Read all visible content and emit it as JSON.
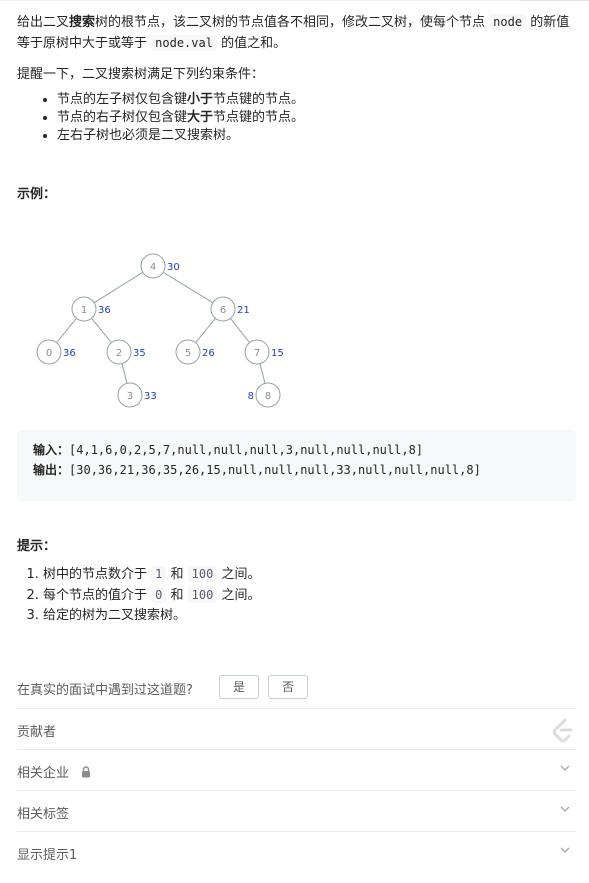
{
  "description": {
    "p1": [
      "给出二叉",
      "搜索",
      "树的根节点，该二叉树的节点值各不相同，修改二叉树，使每个节点 ",
      "node",
      " 的新值等于原树中大于或等于 ",
      "node.val",
      " 的值之和。"
    ],
    "reminder": "提醒一下，二叉搜索树满足下列约束条件：",
    "constraints": [
      [
        "节点的左子树仅包含键",
        "小于",
        "节点键的节点。"
      ],
      [
        "节点的右子树仅包含键",
        "大于",
        "节点键的节点。"
      ],
      [
        "左右子树也必须是二叉搜索树。",
        "",
        ""
      ]
    ]
  },
  "example": {
    "title": "示例：",
    "tree": {
      "nodes": [
        {
          "id": "4",
          "sum": "30"
        },
        {
          "id": "1",
          "sum": "36"
        },
        {
          "id": "6",
          "sum": "21"
        },
        {
          "id": "0",
          "sum": "36"
        },
        {
          "id": "2",
          "sum": "35"
        },
        {
          "id": "5",
          "sum": "26"
        },
        {
          "id": "7",
          "sum": "15"
        },
        {
          "id": "3",
          "sum": "33"
        },
        {
          "id": "8",
          "sum": "8"
        }
      ],
      "colors": {
        "node_stroke": "#9aa0a6",
        "node_text": "#8c8c8c",
        "sum_text": "#1f3ec7",
        "edge": "#9aa0a6"
      }
    },
    "input_label": "输入：",
    "input_value": "[4,1,6,0,2,5,7,null,null,null,3,null,null,null,8]",
    "output_label": "输出：",
    "output_value": "[30,36,21,36,35,26,15,null,null,null,33,null,null,null,8]"
  },
  "hints": {
    "title": "提示：",
    "items": [
      [
        "树中的节点数介于 ",
        "1",
        " 和 ",
        "100",
        " 之间。"
      ],
      [
        "每个节点的值介于 ",
        "0",
        " 和 ",
        "100",
        " 之间。"
      ],
      [
        "给定的树为二叉搜索树。",
        "",
        "",
        "",
        ""
      ]
    ]
  },
  "faq": {
    "question": "在真实的面试中遇到过这道题?",
    "yes": "是",
    "no": "否"
  },
  "sections": [
    {
      "label": "贡献者",
      "icon": "leetcode-logo-icon"
    },
    {
      "label": "相关企业",
      "icon": "chevron-down-icon",
      "lock": "lock-icon"
    },
    {
      "label": "相关标签",
      "icon": "chevron-down-icon"
    },
    {
      "label": "显示提示1",
      "icon": "chevron-down-icon"
    }
  ]
}
